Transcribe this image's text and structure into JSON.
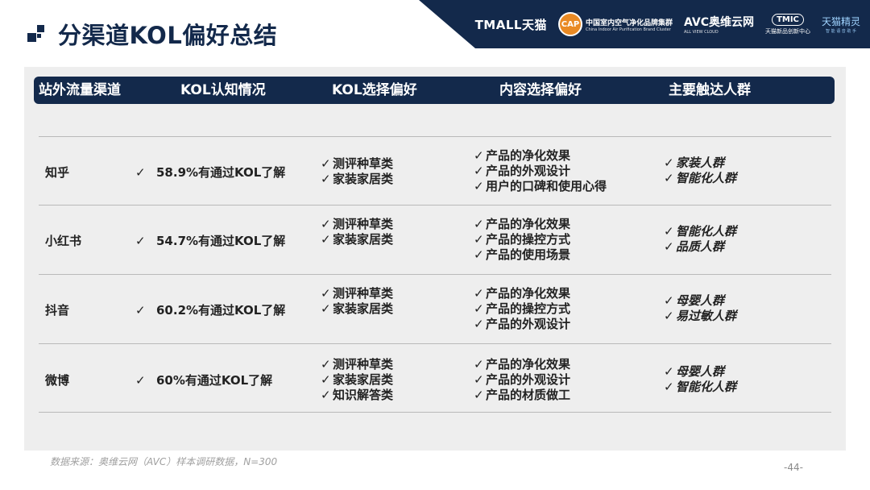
{
  "header": {
    "title": "分渠道KOL偏好总结",
    "band_color": "#13294b",
    "logos": {
      "tmall": "TMALL天猫",
      "cap_badge": "CAP",
      "cap_cn": "中国室内空气净化品牌集群",
      "cap_en": "China Indoor Air Purification Brand Cluster",
      "avc": "AVC奥维云网",
      "avc_en": "ALL VIEW CLOUD",
      "tmic": "TMIC",
      "tmic_sub": "天猫新品创新中心",
      "jingling": "天猫精灵",
      "jingling_sub": "智 能 语 音 助 手"
    }
  },
  "table": {
    "headers": [
      "站外流量渠道",
      "KOL认知情况",
      "KOL选择偏好",
      "内容选择偏好",
      "主要触达人群"
    ],
    "check_mark": "✓",
    "check_mark_list": "✓",
    "rows": [
      {
        "channel": "知乎",
        "awareness": "58.9%有通过KOL了解",
        "prefs": [
          "测评种草类",
          "家装家居类"
        ],
        "content": [
          "产品的净化效果",
          "产品的外观设计",
          "用户的口碑和使用心得"
        ],
        "audience": [
          "家装人群",
          "智能化人群"
        ]
      },
      {
        "channel": "小红书",
        "awareness": "54.7%有通过KOL了解",
        "prefs": [
          "测评种草类",
          "家装家居类"
        ],
        "content": [
          "产品的净化效果",
          "产品的操控方式",
          "产品的使用场景"
        ],
        "audience": [
          "智能化人群",
          "品质人群"
        ]
      },
      {
        "channel": "抖音",
        "awareness": "60.2%有通过KOL了解",
        "prefs": [
          "测评种草类",
          "家装家居类"
        ],
        "content": [
          "产品的净化效果",
          "产品的操控方式",
          "产品的外观设计"
        ],
        "audience": [
          "母婴人群",
          "易过敏人群"
        ]
      },
      {
        "channel": "微博",
        "awareness": "60%有通过KOL了解",
        "prefs": [
          "测评种草类",
          "家装家居类",
          "知识解答类"
        ],
        "content": [
          "产品的净化效果",
          "产品的外观设计",
          "产品的材质做工"
        ],
        "audience": [
          "母婴人群",
          "智能化人群"
        ]
      }
    ]
  },
  "footer": {
    "source": "数据来源：奥维云网（AVC）样本调研数据，N=300",
    "page_number": "-44-"
  }
}
